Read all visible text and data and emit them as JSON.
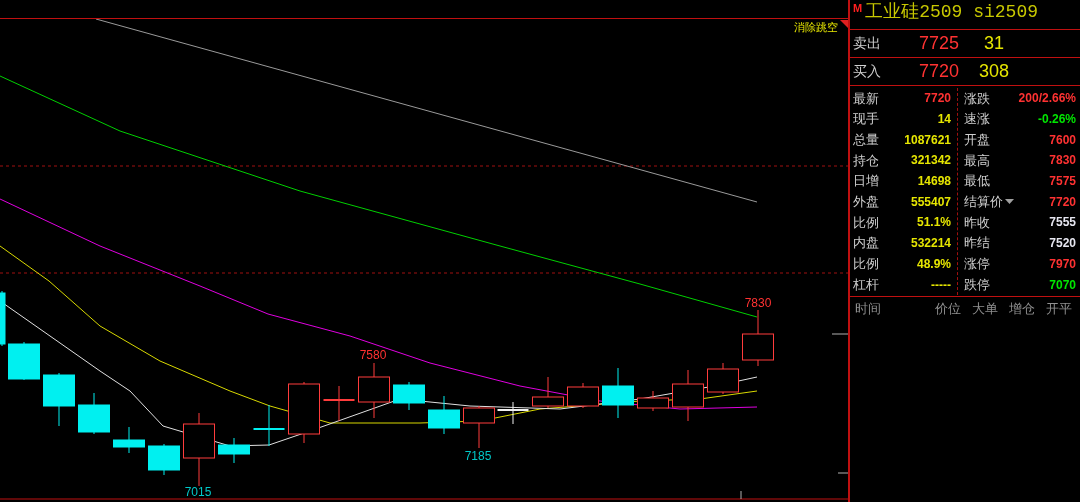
{
  "chart": {
    "toggle": "消除跳空",
    "price_labels": [
      {
        "text": "7830",
        "color": "#ff3232"
      },
      {
        "text": "7580",
        "color": "#ff3232"
      },
      {
        "text": "7185",
        "color": "#00c8c8"
      },
      {
        "text": "7015",
        "color": "#00c8c8"
      }
    ]
  },
  "quote": {
    "marker": "M",
    "title": "工业硅2509 si2509",
    "ask": {
      "label": "卖出",
      "price": "7725",
      "volume": "31"
    },
    "bid": {
      "label": "买入",
      "price": "7720",
      "volume": "308"
    },
    "left_rows": [
      {
        "label": "最新",
        "value": "7720",
        "color": "#ff3232"
      },
      {
        "label": "现手",
        "value": "14",
        "color": "#e6e600"
      },
      {
        "label": "总量",
        "value": "1087621",
        "color": "#e6e600"
      },
      {
        "label": "持仓",
        "value": "321342",
        "color": "#e6e600"
      },
      {
        "label": "日增",
        "value": "14698",
        "color": "#e6e600"
      },
      {
        "label": "外盘",
        "value": "555407",
        "color": "#e6e600"
      },
      {
        "label": "比例",
        "value": "51.1%",
        "color": "#e6e600"
      },
      {
        "label": "内盘",
        "value": "532214",
        "color": "#e6e600"
      },
      {
        "label": "比例",
        "value": "48.9%",
        "color": "#e6e600"
      },
      {
        "label": "杠杆",
        "value": "-----",
        "color": "#e6e600"
      }
    ],
    "right_rows": [
      {
        "label": "涨跌",
        "value": "200/2.66%",
        "color": "#ff3232",
        "kind": "plain"
      },
      {
        "label": "速涨",
        "value": "-0.26%",
        "color": "#00e600",
        "kind": "plain"
      },
      {
        "label": "开盘",
        "value": "7600",
        "color": "#ff3232",
        "kind": "plain"
      },
      {
        "label": "最高",
        "value": "7830",
        "color": "#ff3232",
        "kind": "plain"
      },
      {
        "label": "最低",
        "value": "7575",
        "color": "#ff3232",
        "kind": "plain"
      },
      {
        "label": "结算价",
        "value": "7720",
        "color": "#ff3232",
        "kind": "dropdown"
      },
      {
        "label": "昨收",
        "value": "7555",
        "color": "#e6e6f0",
        "kind": "plain"
      },
      {
        "label": "昨结",
        "value": "7520",
        "color": "#e6e6f0",
        "kind": "plain"
      },
      {
        "label": "涨停",
        "value": "7970",
        "color": "#ff3232",
        "kind": "plain"
      },
      {
        "label": "跌停",
        "value": "7070",
        "color": "#00e600",
        "kind": "plain"
      }
    ]
  },
  "ticks_header": [
    "时间",
    "价位",
    "大单",
    "增仓",
    "开平"
  ]
}
